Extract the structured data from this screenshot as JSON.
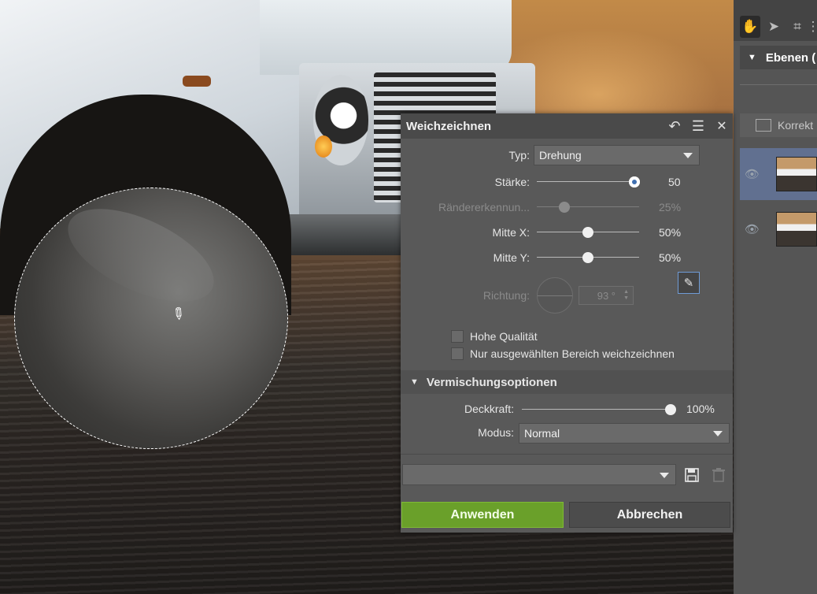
{
  "dialog": {
    "title": "Weichzeichnen",
    "type_label": "Typ:",
    "type_value": "Drehung",
    "strength_label": "Stärke:",
    "strength_value": "50",
    "strength_level": 1.0,
    "edge_label": "Rändererkennun...",
    "edge_value": "25%",
    "edge_level": 0.25,
    "center_x_label": "Mitte X:",
    "center_x_value": "50%",
    "center_y_label": "Mitte Y:",
    "center_y_value": "50%",
    "direction_label": "Richtung:",
    "direction_value": "93 °",
    "high_quality_label": "Hohe Qualität",
    "selected_area_label": "Nur ausgewählten Bereich weichzeichnen",
    "blend_section_label": "Vermischungsoptionen",
    "opacity_label": "Deckkraft:",
    "opacity_value": "100%",
    "mode_label": "Modus:",
    "mode_value": "Normal",
    "apply_label": "Anwenden",
    "cancel_label": "Abbrechen"
  },
  "right_panel": {
    "layers_title": "Ebenen (",
    "corrections_label": "Korrekt"
  },
  "colors": {
    "apply_green": "#6aa02a",
    "selected_layer": "#617090",
    "dialog_bg": "#595959"
  },
  "icons": {
    "undo": "undo-icon",
    "menu": "hamburger-menu-icon",
    "close": "close-icon",
    "save": "floppy-save-icon",
    "delete": "trash-icon",
    "picker": "eyedropper-icon",
    "hand": "hand-tool-icon",
    "arrow": "select-arrow-icon",
    "crop": "crop-icon",
    "eye": "eye-icon"
  }
}
